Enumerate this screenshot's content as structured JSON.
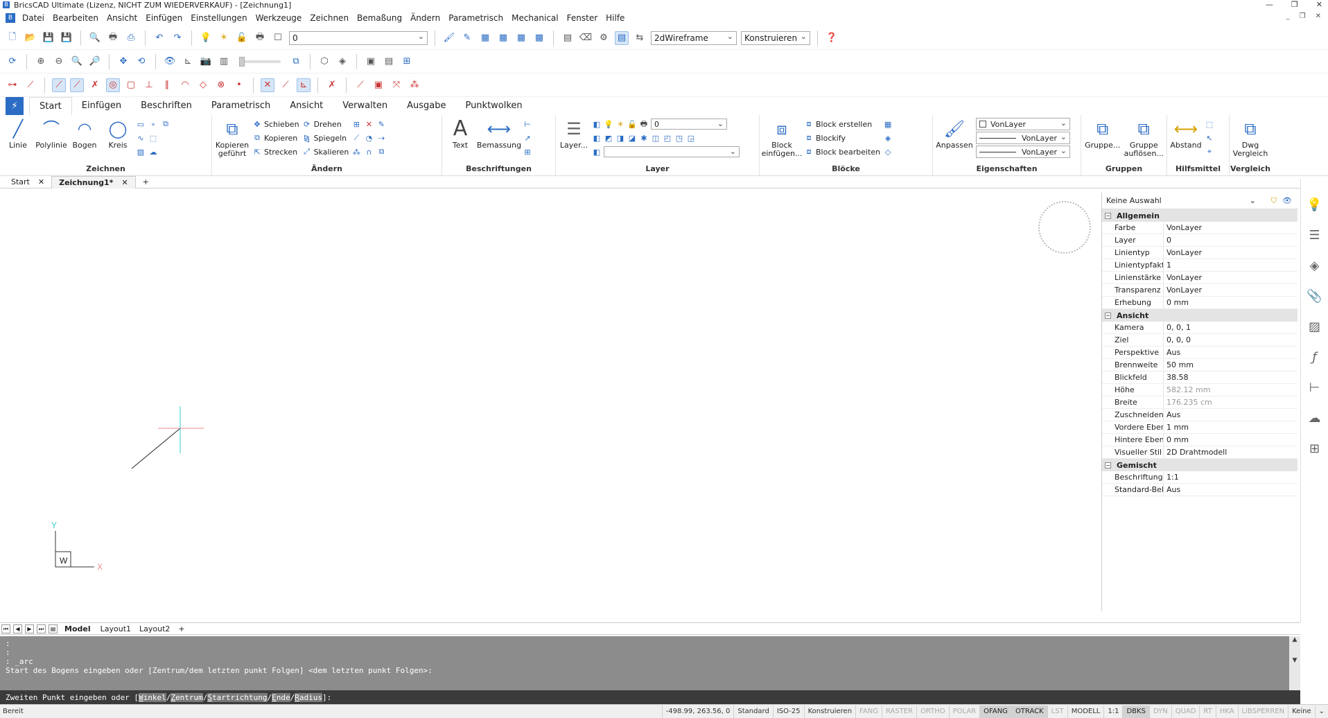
{
  "window": {
    "title": "BricsCAD Ultimate (Lizenz, NICHT ZUM WIEDERVERKAUF) - [Zeichnung1]"
  },
  "menu": [
    "Datei",
    "Bearbeiten",
    "Ansicht",
    "Einfügen",
    "Einstellungen",
    "Werkzeuge",
    "Zeichnen",
    "Bemaßung",
    "Ändern",
    "Parametrisch",
    "Mechanical",
    "Fenster",
    "Hilfe"
  ],
  "toolbar": {
    "layer_value": "0",
    "visual_style": "2dWireframe",
    "workspace": "Konstruieren"
  },
  "ribbon_tabs": [
    "Start",
    "Einfügen",
    "Beschriften",
    "Parametrisch",
    "Ansicht",
    "Verwalten",
    "Ausgabe",
    "Punktwolken"
  ],
  "ribbon": {
    "zeichnen": {
      "title": "Zeichnen",
      "linie": "Linie",
      "polylinie": "Polylinie",
      "bogen": "Bogen",
      "kreis": "Kreis"
    },
    "aendern": {
      "title": "Ändern",
      "kopieren_gefuehrt": "Kopieren geführt",
      "schieben": "Schieben",
      "kopieren": "Kopieren",
      "strecken": "Strecken",
      "drehen": "Drehen",
      "spiegeln": "Spiegeln",
      "skalieren": "Skalieren"
    },
    "beschriftungen": {
      "title": "Beschriftungen",
      "text": "Text",
      "bemassung": "Bemassung"
    },
    "layer": {
      "title": "Layer",
      "layer_btn": "Layer...",
      "layer_value": "0"
    },
    "bloecke": {
      "title": "Blöcke",
      "block_einfuegen": "Block einfügen...",
      "block_erstellen": "Block erstellen",
      "blockify": "Blockify",
      "block_bearbeiten": "Block bearbeiten"
    },
    "eigenschaften": {
      "title": "Eigenschaften",
      "anpassen": "Anpassen",
      "color": "VonLayer",
      "linetype": "VonLayer",
      "lineweight": "VonLayer"
    },
    "gruppen": {
      "title": "Gruppen",
      "gruppe": "Gruppe...",
      "gruppe_aufloesen": "Gruppe auflösen..."
    },
    "hilfsmittel": {
      "title": "Hilfsmittel",
      "abstand": "Abstand"
    },
    "vergleich": {
      "title": "Vergleich",
      "dwg_vergleich": "Dwg Vergleich"
    }
  },
  "doc_tabs": {
    "start": "Start",
    "drawing": "Zeichnung1*",
    "add": "+"
  },
  "properties": {
    "selection": "Keine Auswahl",
    "groups": [
      {
        "name": "Allgemein",
        "rows": [
          {
            "label": "Farbe",
            "value": "VonLayer"
          },
          {
            "label": "Layer",
            "value": "0"
          },
          {
            "label": "Linientyp",
            "value": "VonLayer"
          },
          {
            "label": "Linientypfaktor",
            "value": "1"
          },
          {
            "label": "Linienstärke",
            "value": "VonLayer"
          },
          {
            "label": "Transparenz",
            "value": "VonLayer"
          },
          {
            "label": "Erhebung",
            "value": "0 mm"
          }
        ]
      },
      {
        "name": "Ansicht",
        "rows": [
          {
            "label": "Kamera",
            "value": "0, 0, 1"
          },
          {
            "label": "Ziel",
            "value": "0, 0, 0"
          },
          {
            "label": "Perspektive",
            "value": "Aus"
          },
          {
            "label": "Brennweite",
            "value": "50 mm"
          },
          {
            "label": "Blickfeld",
            "value": "38.58"
          },
          {
            "label": "Höhe",
            "value": "582.12 mm"
          },
          {
            "label": "Breite",
            "value": "176.235 cm"
          },
          {
            "label": "Zuschneiden",
            "value": "Aus"
          },
          {
            "label": "Vordere Ebene",
            "value": "1 mm"
          },
          {
            "label": "Hintere Ebene",
            "value": "0 mm"
          },
          {
            "label": "Visueller Stil",
            "value": "2D Drahtmodell"
          }
        ]
      },
      {
        "name": "Gemischt",
        "rows": [
          {
            "label": "Beschriftungs Ski",
            "value": "1:1"
          },
          {
            "label": "Standard-Beleucl",
            "value": "Aus"
          }
        ]
      }
    ]
  },
  "ucs": {
    "x_label": "X",
    "y_label": "Y",
    "w_label": "W"
  },
  "layout_tabs": [
    "Model",
    "Layout1",
    "Layout2",
    "+"
  ],
  "command": {
    "history": [
      ":",
      ":",
      ": _arc",
      "Start des Bogens eingeben oder [Zentrum/dem letzten punkt Folgen] <dem letzten punkt Folgen>:"
    ],
    "prompt_prefix": "Zweiten Punkt eingeben oder [",
    "options": [
      {
        "hot": "W",
        "rest": "inkel"
      },
      {
        "hot": "Z",
        "rest": "entrum"
      },
      {
        "hot": "S",
        "rest": "tartrichtung"
      },
      {
        "hot": "E",
        "rest": "nde"
      },
      {
        "hot": "R",
        "rest": "adius"
      }
    ],
    "prompt_suffix": "]:"
  },
  "status": {
    "left": "Bereit",
    "coords": "-498.99, 263.56, 0",
    "items": [
      {
        "label": "Standard",
        "state": "text"
      },
      {
        "label": "ISO-25",
        "state": "text"
      },
      {
        "label": "Konstruieren",
        "state": "text"
      },
      {
        "label": "FANG",
        "state": "off"
      },
      {
        "label": "RASTER",
        "state": "off"
      },
      {
        "label": "ORTHO",
        "state": "off"
      },
      {
        "label": "POLAR",
        "state": "off"
      },
      {
        "label": "OFANG",
        "state": "on"
      },
      {
        "label": "OTRACK",
        "state": "on"
      },
      {
        "label": "LST",
        "state": "off"
      },
      {
        "label": "MODELL",
        "state": "text"
      },
      {
        "label": "1:1",
        "state": "text"
      },
      {
        "label": "DBKS",
        "state": "on"
      },
      {
        "label": "DYN",
        "state": "off"
      },
      {
        "label": "QUAD",
        "state": "off"
      },
      {
        "label": "RT",
        "state": "off"
      },
      {
        "label": "HKA",
        "state": "off"
      },
      {
        "label": "LIBSPERREN",
        "state": "off"
      },
      {
        "label": "Keine",
        "state": "text"
      }
    ]
  },
  "colors": {
    "accent": "#2b6cc4",
    "command_bg": "#8c8c8c",
    "prompt_bg": "#3b3b3b",
    "cursor": "#3cc"
  }
}
